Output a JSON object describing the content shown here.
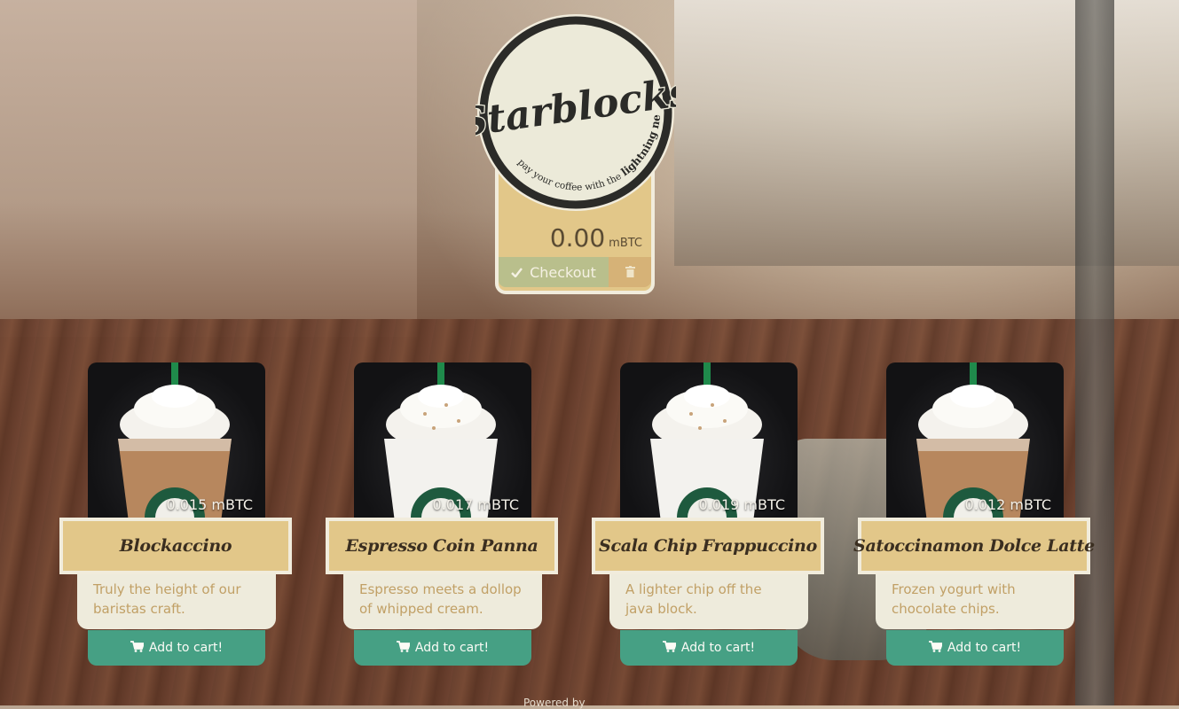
{
  "brand": {
    "name": "Starblocks",
    "tagline_prefix": "pay your coffee with the",
    "tagline_emphasis": "lightning network"
  },
  "cart": {
    "total": "0.00",
    "unit": "mBTC",
    "checkout_label": "Checkout"
  },
  "products": [
    {
      "name": "Blockaccino",
      "price": "0.015 mBTC",
      "description": "Truly the height of our baristas craft.",
      "button": "Add to cart!"
    },
    {
      "name": "Espresso Coin Panna",
      "price": "0.017 mBTC",
      "description": "Espresso meets a dollop of whipped cream.",
      "button": "Add to cart!"
    },
    {
      "name": "Scala Chip Frappuccino",
      "price": "0.019 mBTC",
      "description": "A lighter chip off the java block.",
      "button": "Add to cart!"
    },
    {
      "name": "Satoccinamon Dolce Latte",
      "price": "0.012 mBTC",
      "description": "Frozen yogurt with chocolate chips.",
      "button": "Add to cart!"
    }
  ],
  "footer": {
    "text": "Powered by"
  },
  "colors": {
    "accent": "#46a084",
    "gold": "#e2c789",
    "cream": "#f1ecdc"
  }
}
